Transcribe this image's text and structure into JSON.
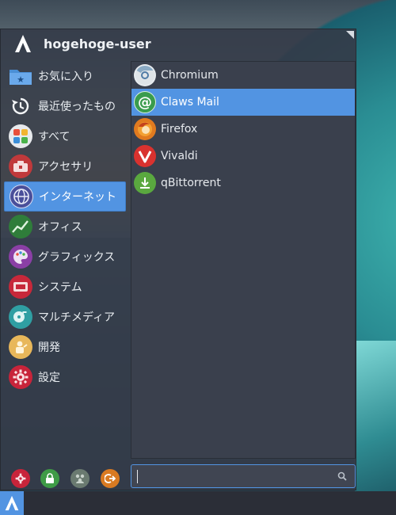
{
  "header": {
    "username": "hogehoge-user"
  },
  "categories": [
    {
      "label": "お気に入り",
      "icon": "favorites-folder-icon",
      "active": false
    },
    {
      "label": "最近使ったもの",
      "icon": "recent-history-icon",
      "active": false
    },
    {
      "label": "すべて",
      "icon": "all-apps-icon",
      "active": false
    },
    {
      "label": "アクセサリ",
      "icon": "accessories-icon",
      "active": false
    },
    {
      "label": "インターネット",
      "icon": "internet-globe-icon",
      "active": true
    },
    {
      "label": "オフィス",
      "icon": "office-chart-icon",
      "active": false
    },
    {
      "label": "グラフィックス",
      "icon": "graphics-palette-icon",
      "active": false
    },
    {
      "label": "システム",
      "icon": "system-icon",
      "active": false
    },
    {
      "label": "マルチメディア",
      "icon": "multimedia-icon",
      "active": false
    },
    {
      "label": "開発",
      "icon": "development-icon",
      "active": false
    },
    {
      "label": "設定",
      "icon": "settings-gear-icon",
      "active": false
    }
  ],
  "apps": [
    {
      "label": "Chromium",
      "icon": "chromium-icon",
      "active": false
    },
    {
      "label": "Claws Mail",
      "icon": "claws-mail-icon",
      "active": true
    },
    {
      "label": "Firefox",
      "icon": "firefox-icon",
      "active": false
    },
    {
      "label": "Vivaldi",
      "icon": "vivaldi-icon",
      "active": false
    },
    {
      "label": "qBittorrent",
      "icon": "qbittorrent-icon",
      "active": false
    }
  ],
  "search": {
    "value": "",
    "placeholder": ""
  },
  "colors": {
    "accent": "#5294e2",
    "menu_bg": "#343b48",
    "panel_bg": "#3a404d"
  }
}
